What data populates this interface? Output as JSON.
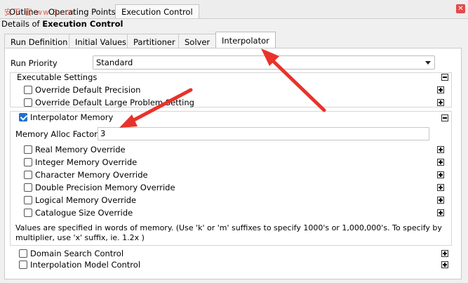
{
  "top_tabs": [
    {
      "label": "Outline"
    },
    {
      "label": "Operating Points"
    },
    {
      "label": "Execution Control"
    }
  ],
  "watermark": "安下 官 ww 3..cn",
  "details": {
    "prefix": "Details of ",
    "title": "Execution Control"
  },
  "sub_tabs": [
    {
      "label": "Run Definition"
    },
    {
      "label": "Initial Values"
    },
    {
      "label": "Partitioner"
    },
    {
      "label": "Solver"
    },
    {
      "label": "Interpolator"
    }
  ],
  "run_priority": {
    "label": "Run Priority",
    "value": "Standard"
  },
  "executable_settings": {
    "label": "Executable Settings",
    "items": [
      {
        "label": "Override Default Precision",
        "checked": false
      },
      {
        "label": "Override Default Large Problem Setting",
        "checked": false
      }
    ]
  },
  "interpolator_memory": {
    "label": "Interpolator Memory",
    "checked": true,
    "alloc_label": "Memory Alloc Factor",
    "alloc_value": "3",
    "overrides": [
      {
        "label": "Real Memory Override"
      },
      {
        "label": "Integer Memory Override"
      },
      {
        "label": "Character Memory Override"
      },
      {
        "label": "Double Precision Memory Override"
      },
      {
        "label": "Logical Memory Override"
      },
      {
        "label": "Catalogue Size Override"
      }
    ],
    "note": "Values are specified in words of memory. (Use 'k' or 'm' suffixes to specify 1000's or 1,000,000's. To specify by multiplier, use 'x' suffix, ie. 1.2x )"
  },
  "bottom_sections": [
    {
      "label": "Domain Search Control"
    },
    {
      "label": "Interpolation Model Control"
    }
  ],
  "colors": {
    "accent": "#1f6fd1",
    "annotation_arrow": "#e8332a"
  }
}
